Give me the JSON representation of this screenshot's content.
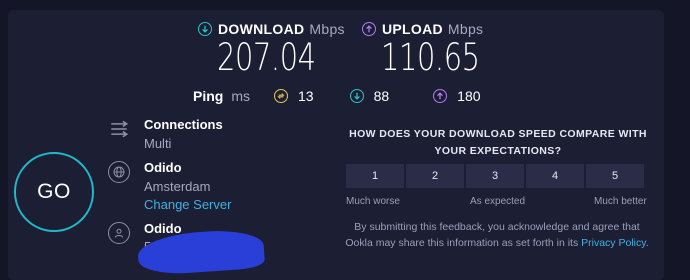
{
  "download": {
    "label": "DOWNLOAD",
    "unit": "Mbps",
    "value": "207.04",
    "color": "#2ac3c8"
  },
  "upload": {
    "label": "UPLOAD",
    "unit": "Mbps",
    "value": "110.65",
    "color": "#b07cf2"
  },
  "ping": {
    "label": "Ping",
    "unit": "ms",
    "idle": {
      "value": "13",
      "color": "#e8c55a"
    },
    "download": {
      "value": "88",
      "color": "#2ac3c8"
    },
    "upload": {
      "value": "180",
      "color": "#b07cf2"
    }
  },
  "go_button": {
    "label": "GO",
    "color": "#1fb9c8"
  },
  "connections": {
    "title": "Connections",
    "value": "Multi"
  },
  "host": {
    "title": "Odido",
    "location": "Amsterdam",
    "change_link": "Change Server"
  },
  "provider": {
    "title": "Odido",
    "ip_partial": "5"
  },
  "feedback": {
    "question": "HOW DOES YOUR DOWNLOAD SPEED COMPARE WITH YOUR EXPECTATIONS?",
    "options": [
      "1",
      "2",
      "3",
      "4",
      "5"
    ],
    "low_label": "Much worse",
    "mid_label": "As expected",
    "high_label": "Much better",
    "disclaimer_text": "By submitting this feedback, you acknowledge and agree that Ookla may share this information as set forth in its ",
    "privacy_link": "Privacy Policy",
    "disclaimer_end": "."
  },
  "colors": {
    "background": "#141526",
    "panel": "#1c1e33",
    "link": "#3fb1e3",
    "redaction": "#2a3fd8"
  }
}
